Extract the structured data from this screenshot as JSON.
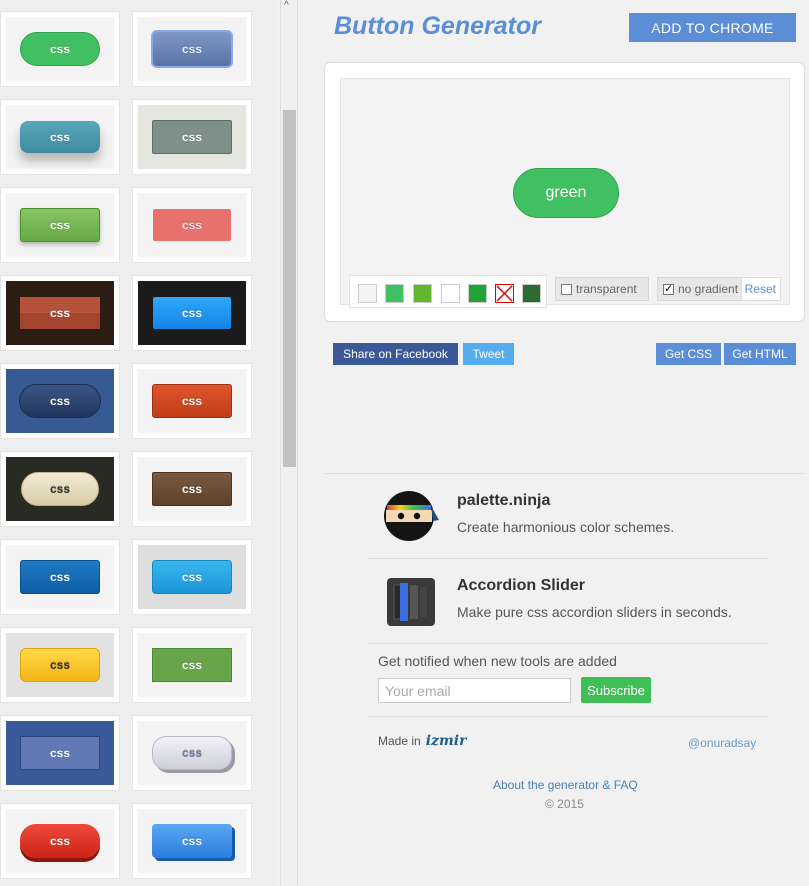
{
  "gallery": {
    "rows": [
      {
        "left": {
          "label": "css",
          "style": "green-pill"
        },
        "right": {
          "label": "css",
          "style": "blue-outline"
        }
      },
      {
        "left": {
          "label": "css",
          "style": "teal-shadow"
        },
        "right": {
          "label": "css",
          "style": "gray-flat"
        }
      },
      {
        "left": {
          "label": "css",
          "style": "green-flat"
        },
        "right": {
          "label": "css",
          "style": "salmon-flat"
        }
      },
      {
        "left": {
          "label": "css",
          "style": "brown-dark"
        },
        "right": {
          "label": "css",
          "style": "cyan-dark"
        }
      },
      {
        "left": {
          "label": "css",
          "style": "navy-pill"
        },
        "right": {
          "label": "css",
          "style": "orange-red"
        }
      },
      {
        "left": {
          "label": "css",
          "style": "cream-pill"
        },
        "right": {
          "label": "css",
          "style": "brown-flat"
        }
      },
      {
        "left": {
          "label": "css",
          "style": "blue-flat"
        },
        "right": {
          "label": "css",
          "style": "sky-blue"
        }
      },
      {
        "left": {
          "label": "css",
          "style": "yellow"
        },
        "right": {
          "label": "css",
          "style": "green-box"
        }
      },
      {
        "left": {
          "label": "css",
          "style": "indigo"
        },
        "right": {
          "label": "css",
          "style": "silver-pill"
        }
      },
      {
        "left": {
          "label": "css",
          "style": "red-pill"
        },
        "right": {
          "label": "css",
          "style": "blue-3d"
        }
      }
    ]
  },
  "header": {
    "title": "Button Generator",
    "add_chrome": "ADD TO CHROME"
  },
  "preview": {
    "button_label": "green",
    "swatches": [
      {
        "name": "swatch-light-gray",
        "color": "#f3f3f3"
      },
      {
        "name": "swatch-green",
        "color": "#40c060"
      },
      {
        "name": "swatch-lime",
        "color": "#63b52f"
      },
      {
        "name": "swatch-white",
        "color": "#ffffff"
      },
      {
        "name": "swatch-dark-green",
        "color": "#1ea534"
      },
      {
        "name": "swatch-none",
        "color": "#ffffff"
      },
      {
        "name": "swatch-forest",
        "color": "#2e6b33"
      }
    ],
    "transparent_label": "transparent",
    "no_gradient_label": "no gradient",
    "reset_label": "Reset"
  },
  "actions": {
    "facebook": "Share on Facebook",
    "tweet": "Tweet",
    "get_css": "Get CSS",
    "get_html": "Get HTML"
  },
  "tools": [
    {
      "name": "palette.ninja",
      "desc": "Create harmonious color schemes."
    },
    {
      "name": "Accordion Slider",
      "desc": "Make pure css accordion sliders in seconds."
    }
  ],
  "newsletter": {
    "label": "Get notified when new tools are added",
    "placeholder": "Your email",
    "subscribe": "Subscribe"
  },
  "footer": {
    "made_in": "Made in",
    "city_logo": "izmir",
    "handle": "@onuradsay",
    "about": "About the generator & FAQ",
    "copyright": "© 2015"
  },
  "colors": {
    "accent": "#5b8ed6",
    "facebook": "#3b5998",
    "twitter": "#55acee",
    "subscribe": "#3fbf55"
  }
}
